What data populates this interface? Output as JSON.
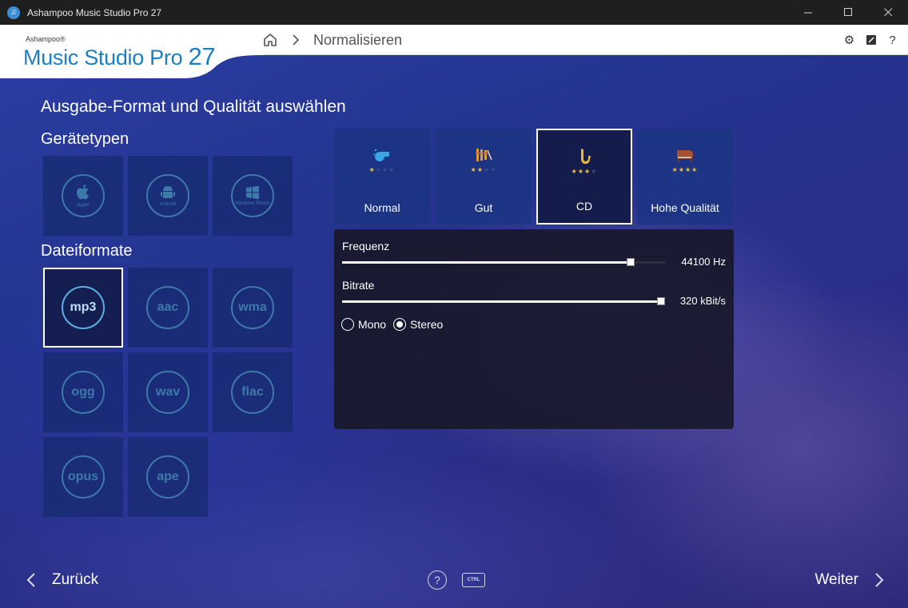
{
  "window": {
    "title": "Ashampoo Music Studio Pro 27",
    "controls": [
      "minimize",
      "maximize",
      "close"
    ]
  },
  "logo": {
    "brand": "Ashampoo®",
    "product": "Music Studio Pro",
    "version": "27",
    "color": "#1b7fc4"
  },
  "breadcrumb": {
    "home_icon": "home-icon",
    "current": "Normalisieren"
  },
  "header_icons": [
    "gear-icon",
    "feedback-icon",
    "help-icon"
  ],
  "page": {
    "title": "Ausgabe-Format und Qualität auswählen"
  },
  "device_types": {
    "heading": "Gerätetypen",
    "items": [
      {
        "label": "Apple",
        "icon": "apple-icon"
      },
      {
        "label": "Android",
        "icon": "android-icon"
      },
      {
        "label": "Windows Phone",
        "icon": "windows-icon"
      }
    ]
  },
  "file_formats": {
    "heading": "Dateiformate",
    "selected": "mp3",
    "items": [
      "mp3",
      "aac",
      "wma",
      "ogg",
      "wav",
      "flac",
      "opus",
      "ape"
    ]
  },
  "quality": {
    "selected": "CD",
    "items": [
      {
        "label": "Normal",
        "stars": 1,
        "icon": "whistle-icon"
      },
      {
        "label": "Gut",
        "stars": 2,
        "icon": "xylophone-icon"
      },
      {
        "label": "CD",
        "stars": 3,
        "icon": "saxophone-icon"
      },
      {
        "label": "Hohe Qualität",
        "stars": 4,
        "icon": "grand-piano-icon"
      }
    ]
  },
  "settings": {
    "frequency": {
      "label": "Frequenz",
      "value": "44100 Hz",
      "level": 0.89
    },
    "bitrate": {
      "label": "Bitrate",
      "value": "320 kBit/s",
      "level": 1.0
    },
    "channels": {
      "options": [
        "Mono",
        "Stereo"
      ],
      "selected": "Stereo"
    }
  },
  "footer": {
    "back_label": "Zurück",
    "next_label": "Weiter",
    "help_icon": "help-circle-icon",
    "ctrl_label": "CTRL"
  }
}
